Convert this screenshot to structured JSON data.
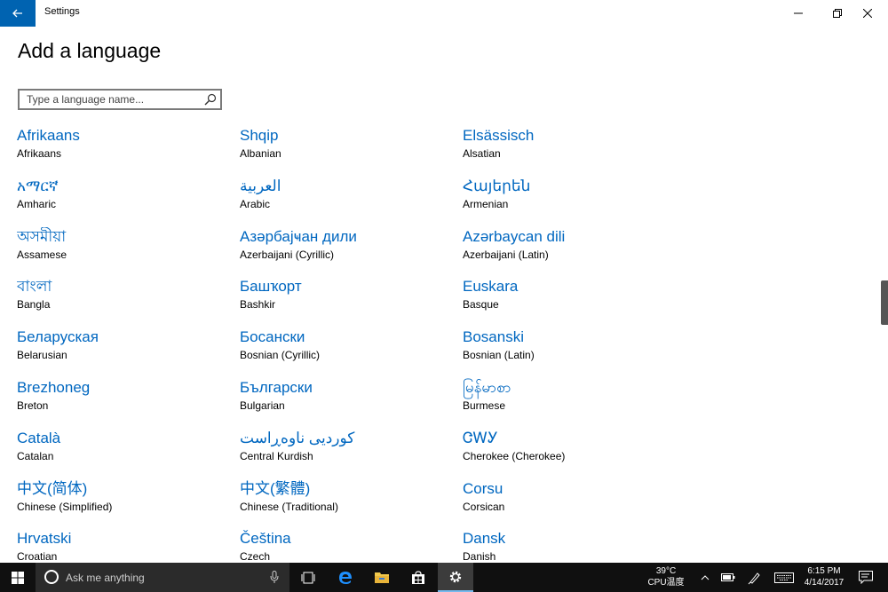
{
  "window": {
    "app_title": "Settings"
  },
  "page": {
    "title": "Add a language",
    "search_placeholder": "Type a language name..."
  },
  "languages": [
    {
      "native": "Afrikaans",
      "english": "Afrikaans"
    },
    {
      "native": "Shqip",
      "english": "Albanian"
    },
    {
      "native": "Elsässisch",
      "english": "Alsatian"
    },
    {
      "native": "አማርኛ",
      "english": "Amharic"
    },
    {
      "native": "العربية",
      "english": "Arabic"
    },
    {
      "native": "Հայերեն",
      "english": "Armenian"
    },
    {
      "native": "অসমীয়া",
      "english": "Assamese"
    },
    {
      "native": "Азәрбајҹан дили",
      "english": "Azerbaijani (Cyrillic)"
    },
    {
      "native": "Azərbaycan dili",
      "english": "Azerbaijani (Latin)"
    },
    {
      "native": "বাংলা",
      "english": "Bangla"
    },
    {
      "native": "Башҡорт",
      "english": "Bashkir"
    },
    {
      "native": "Euskara",
      "english": "Basque"
    },
    {
      "native": "Беларуская",
      "english": "Belarusian"
    },
    {
      "native": "Босански",
      "english": "Bosnian (Cyrillic)"
    },
    {
      "native": "Bosanski",
      "english": "Bosnian (Latin)"
    },
    {
      "native": "Brezhoneg",
      "english": "Breton"
    },
    {
      "native": "Български",
      "english": "Bulgarian"
    },
    {
      "native": "မြန်မာစာ",
      "english": "Burmese"
    },
    {
      "native": "Català",
      "english": "Catalan"
    },
    {
      "native": "کوردیی ناوەڕاست",
      "english": "Central Kurdish"
    },
    {
      "native": "ᏣᎳᎩ",
      "english": "Cherokee (Cherokee)"
    },
    {
      "native": "中文(简体)",
      "english": "Chinese (Simplified)"
    },
    {
      "native": "中文(繁體)",
      "english": "Chinese (Traditional)"
    },
    {
      "native": "Corsu",
      "english": "Corsican"
    },
    {
      "native": "Hrvatski",
      "english": "Croatian"
    },
    {
      "native": "Čeština",
      "english": "Czech"
    },
    {
      "native": "Dansk",
      "english": "Danish"
    }
  ],
  "taskbar": {
    "search_placeholder": "Ask me anything",
    "temperature": "39°C",
    "cpu_label": "CPU温度",
    "time": "6:15 PM",
    "date": "4/14/2017"
  },
  "colors": {
    "accent": "#0063b1",
    "link": "#0067c0",
    "taskbar": "#101010"
  }
}
